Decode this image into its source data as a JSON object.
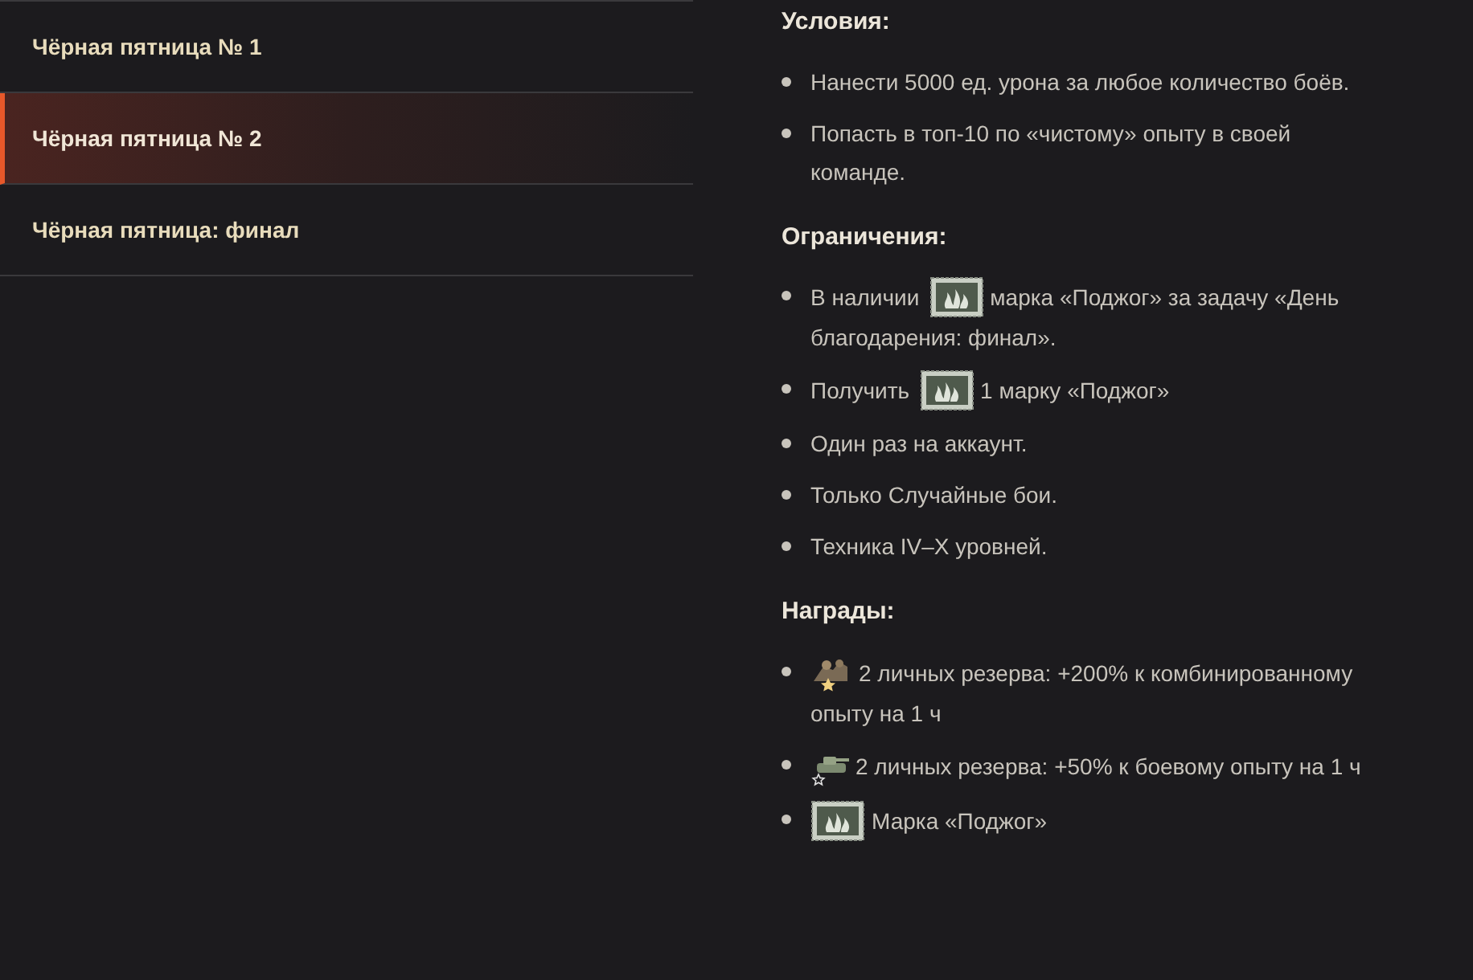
{
  "tasks": [
    {
      "label": "Чёрная пятница № 1",
      "selected": false
    },
    {
      "label": "Чёрная пятница № 2",
      "selected": true
    },
    {
      "label": "Чёрная пятница: финал",
      "selected": false
    }
  ],
  "sections": [
    {
      "title": "Условия:",
      "items": [
        {
          "kind": "text",
          "text": "Нанести 5000 ед. урона за любое количество боёв."
        },
        {
          "kind": "text",
          "text": "Попасть в топ-10 по «чистому» опыту в своей команде."
        }
      ]
    },
    {
      "title": "Ограничения:",
      "items": [
        {
          "kind": "stamp",
          "before": "В наличии",
          "lines": [
            "марка «Поджог» за задачу «День",
            "благодарения: финал»."
          ]
        },
        {
          "kind": "stamp",
          "before": "Получить",
          "lines": [
            "1 марку «Поджог»"
          ]
        },
        {
          "kind": "text",
          "text": "Один раз на аккаунт."
        },
        {
          "kind": "text",
          "text": "Только Случайные бои."
        },
        {
          "kind": "text",
          "text": "Техника IV–X уровней."
        }
      ]
    },
    {
      "title": "Награды:",
      "items": [
        {
          "kind": "reserve-crew",
          "lines": [
            "2 личных резерва: +200% к комбинированному",
            "опыту на 1 ч"
          ]
        },
        {
          "kind": "reserve-tank",
          "lines": [
            "2 личных резерва: +50% к боевому опыту на 1 ч"
          ]
        },
        {
          "kind": "stamp",
          "lines": [
            "Марка «Поджог»"
          ]
        }
      ]
    }
  ]
}
